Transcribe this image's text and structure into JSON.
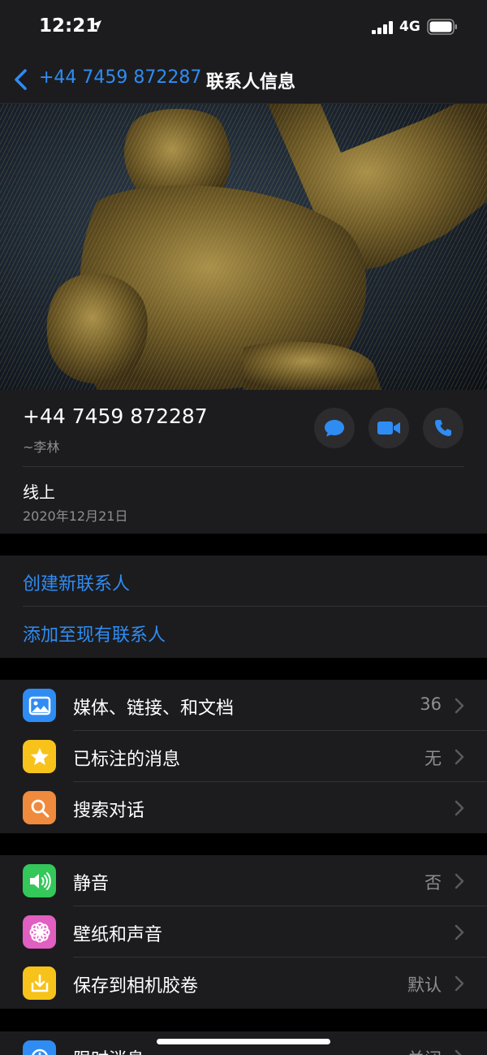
{
  "status_bar": {
    "time": "12:21",
    "network": "4G"
  },
  "nav": {
    "back_label": "+44 7459 872287",
    "title": "联系人信息"
  },
  "contact": {
    "phone": "+44 7459 872287",
    "push_name": "~李林",
    "about": "线上",
    "about_date": "2020年12月21日"
  },
  "actions": [
    "message-icon",
    "video-call-icon",
    "voice-call-icon"
  ],
  "contact_links": [
    {
      "label": "创建新联系人"
    },
    {
      "label": "添加至现有联系人"
    }
  ],
  "menu_group_1": [
    {
      "label": "媒体、链接、和文档",
      "value": "36",
      "icon": "photo-icon",
      "color": "#2f8cf3"
    },
    {
      "label": "已标注的消息",
      "value": "无",
      "icon": "star-icon",
      "color": "#f7c31a"
    },
    {
      "label": "搜索对话",
      "value": "",
      "icon": "search-icon",
      "color": "#f08a3c"
    }
  ],
  "menu_group_2": [
    {
      "label": "静音",
      "value": "否",
      "icon": "speaker-icon",
      "color": "#34c759"
    },
    {
      "label": "壁纸和声音",
      "value": "",
      "icon": "flower-icon",
      "color": "#e05fc0"
    },
    {
      "label": "保存到相机胶卷",
      "value": "默认",
      "icon": "download-icon",
      "color": "#f7c31a"
    }
  ],
  "menu_group_3": [
    {
      "label": "限时消息",
      "value": "关闭",
      "icon": "timer-icon",
      "color": "#2f8cf3"
    }
  ],
  "colors": {
    "accent": "#2f8cf3",
    "background": "#000000",
    "card": "#1c1c1e"
  }
}
